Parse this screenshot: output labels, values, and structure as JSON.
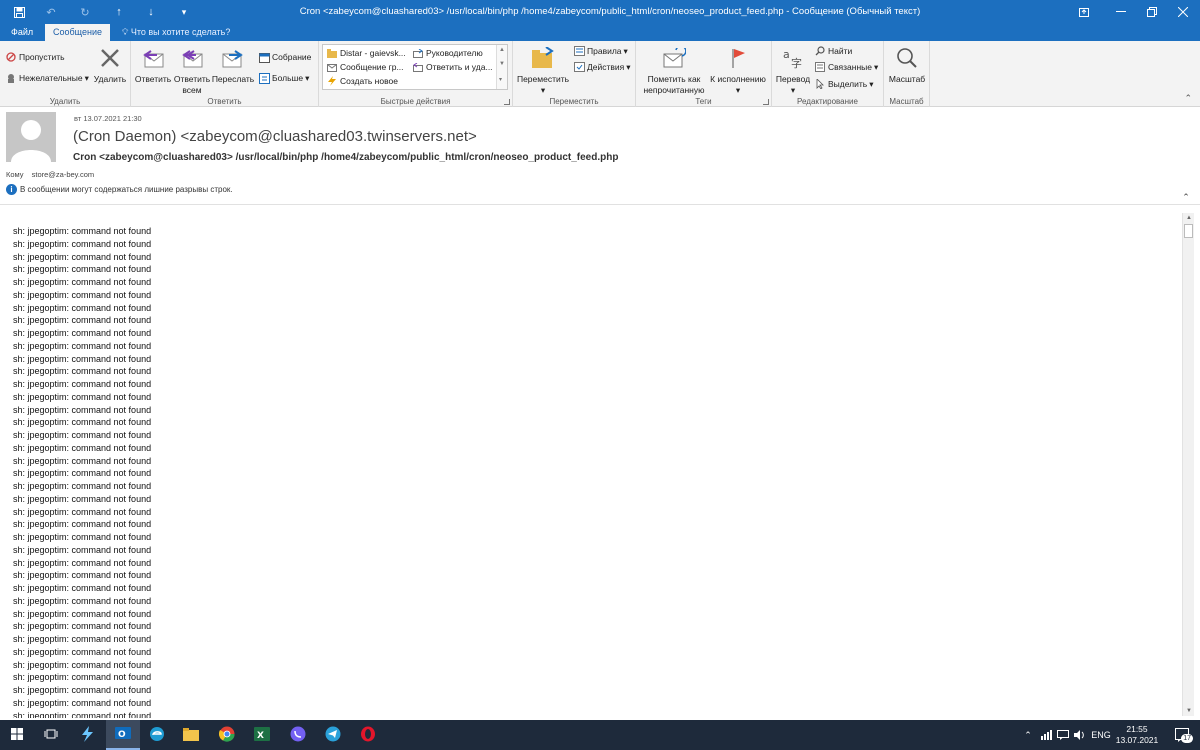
{
  "titlebar": {
    "title": "Cron <zabeycom@cluashared03> /usr/local/bin/php /home4/zabeycom/public_html/cron/neoseo_product_feed.php - Сообщение (Обычный текст)"
  },
  "tabs": [
    {
      "label": "Файл"
    },
    {
      "label": "Сообщение"
    }
  ],
  "tell_me": "Что вы хотите сделать?",
  "ribbon": {
    "delete_group": {
      "label": "Удалить",
      "ignore": "Пропустить",
      "junk": "Нежелательные",
      "delete": "Удалить"
    },
    "respond_group": {
      "label": "Ответить",
      "reply": "Ответить",
      "reply_all_1": "Ответить",
      "reply_all_2": "всем",
      "forward": "Переслать",
      "meeting": "Собрание",
      "more": "Больше"
    },
    "quick_steps": {
      "label": "Быстрые действия",
      "items": [
        "Distar - gaievsk...",
        "Руководителю",
        "Сообщение гр...",
        "Ответить и уда...",
        "Создать новое"
      ]
    },
    "move_group": {
      "label": "Переместить",
      "move": "Переместить",
      "rules": "Правила",
      "actions": "Действия"
    },
    "tags_group": {
      "label": "Теги",
      "mark_unread_1": "Пометить как",
      "mark_unread_2": "непрочитанную",
      "follow_up": "К исполнению"
    },
    "editing_group": {
      "label": "Редактирование",
      "translate": "Перевод",
      "find": "Найти",
      "related": "Связанные",
      "select": "Выделить"
    },
    "zoom_group": {
      "label": "Масштаб",
      "zoom": "Масштаб"
    }
  },
  "message": {
    "sent": "вт 13.07.2021 21:30",
    "sender": "(Cron Daemon) <zabeycom@cluashared03.twinservers.net>",
    "subject": "Cron <zabeycom@cluashared03> /usr/local/bin/php /home4/zabeycom/public_html/cron/neoseo_product_feed.php",
    "to_label": "Кому",
    "to_value": "store@za-bey.com",
    "info": "В сообщении могут содержаться лишние разрывы строк.",
    "body_line": "sh: jpegoptim: command not found"
  },
  "taskbar": {
    "lang": "ENG",
    "time": "21:55",
    "date": "13.07.2021",
    "notifications": "17",
    "colors": {
      "outlook": "#0f6cbd",
      "edge": "#1f9cd3",
      "explorer": "#f2c44c",
      "chrome": "#e34133",
      "excel": "#1d7044",
      "viber": "#7360f2",
      "telegram": "#2aa1da",
      "opera": "#e3162b"
    }
  }
}
